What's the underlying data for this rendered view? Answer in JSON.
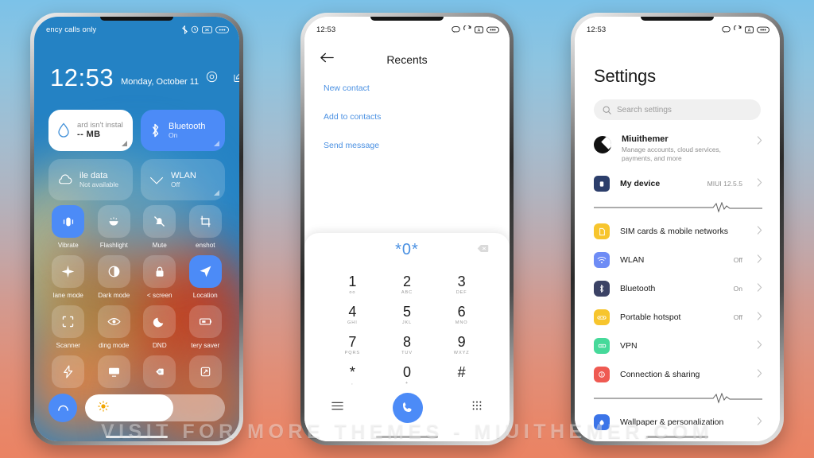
{
  "background": {
    "top_color": "#7cc2e8",
    "bottom_color": "#ea8363"
  },
  "watermark": {
    "text": "VISIT FOR MORE THEMES - MIUITHEMER.COM"
  },
  "phone1": {
    "name": "control-center",
    "statusbar": {
      "carrier": "ency calls only",
      "icons": [
        "bluetooth-icon",
        "alarm-icon",
        "mute-icon",
        "battery-icon"
      ]
    },
    "clock": {
      "time": "12:53",
      "date": "Monday, October 11",
      "icons": [
        "settings-gear-icon",
        "edit-icon"
      ]
    },
    "cards": [
      {
        "name": "storage-card",
        "icon": "water-drop-icon",
        "title": "ard isn't instal",
        "subtitle": "-- MB",
        "state": "white"
      },
      {
        "name": "bluetooth-card",
        "icon": "bluetooth-icon",
        "title": "Bluetooth",
        "subtitle": "On",
        "state": "on"
      },
      {
        "name": "mobile-data-card",
        "icon": "cloud-icon",
        "title": "ile data",
        "subtitle": "Not available",
        "state": "off"
      },
      {
        "name": "wlan-card",
        "icon": "wifi-icon",
        "title": "WLAN",
        "subtitle": "Off",
        "state": "off"
      }
    ],
    "tiles": [
      {
        "label": "Vibrate",
        "icon": "vibrate-icon",
        "active": true
      },
      {
        "label": "Flashlight",
        "icon": "flashlight-icon",
        "active": false
      },
      {
        "label": "Mute",
        "icon": "bell-off-icon",
        "active": false
      },
      {
        "label": "enshot",
        "icon": "screenshot-icon",
        "active": false
      },
      {
        "label": "lane mode",
        "icon": "airplane-icon",
        "active": false
      },
      {
        "label": "Dark mode",
        "icon": "contrast-icon",
        "active": false
      },
      {
        "label": "< screen",
        "icon": "lock-icon",
        "active": false
      },
      {
        "label": "Location",
        "icon": "location-icon",
        "active": true
      },
      {
        "label": "Scanner",
        "icon": "scanner-icon",
        "active": false
      },
      {
        "label": "ding mode",
        "icon": "eye-icon",
        "active": false
      },
      {
        "label": "DND",
        "icon": "moon-icon",
        "active": false
      },
      {
        "label": "tery saver",
        "icon": "battery-saver-icon",
        "active": false
      },
      {
        "label": "",
        "icon": "bolt-icon",
        "active": false
      },
      {
        "label": "",
        "icon": "cast-icon",
        "active": false
      },
      {
        "label": "",
        "icon": "reading-icon",
        "active": false
      },
      {
        "label": "",
        "icon": "rotate-icon",
        "active": false
      }
    ],
    "brightness": {
      "icon": "brightness-icon",
      "level_percent": 63,
      "left_button_icon": "arc-icon"
    }
  },
  "phone2": {
    "name": "dialer",
    "statusbar": {
      "time": "12:53",
      "icons": [
        "chat-icon",
        "rotate-icon",
        "vol-icon",
        "battery-icon"
      ]
    },
    "nav": {
      "back_icon": "back-arrow-icon",
      "title": "Recents"
    },
    "actions": [
      {
        "label": "New contact"
      },
      {
        "label": "Add to contacts"
      },
      {
        "label": "Send message"
      }
    ],
    "dialpad": {
      "number": "*0*",
      "delete_icon": "backspace-icon",
      "keys": [
        {
          "digit": "1",
          "letters": "oo"
        },
        {
          "digit": "2",
          "letters": "ABC"
        },
        {
          "digit": "3",
          "letters": "DEF"
        },
        {
          "digit": "4",
          "letters": "GHI"
        },
        {
          "digit": "5",
          "letters": "JKL"
        },
        {
          "digit": "6",
          "letters": "MNO"
        },
        {
          "digit": "7",
          "letters": "PQRS"
        },
        {
          "digit": "8",
          "letters": "TUV"
        },
        {
          "digit": "9",
          "letters": "WXYZ"
        },
        {
          "digit": "*",
          "letters": ","
        },
        {
          "digit": "0",
          "letters": "+"
        },
        {
          "digit": "#",
          "letters": ""
        }
      ],
      "left_icon": "menu-icon",
      "call_icon": "phone-icon",
      "right_icon": "keypad-icon"
    }
  },
  "phone3": {
    "name": "settings",
    "statusbar": {
      "time": "12:53",
      "icons": [
        "chat-icon",
        "rotate-icon",
        "vol-icon",
        "battery-icon"
      ]
    },
    "title": "Settings",
    "search": {
      "icon": "search-icon",
      "placeholder": "Search settings"
    },
    "account": {
      "name": "Miuithemer",
      "subtitle": "Manage accounts, cloud services, payments, and more",
      "avatar": "profile-avatar"
    },
    "rows": [
      {
        "label": "My device",
        "value": "MIUI 12.5.5",
        "icon": "device-icon",
        "color": "#2c3e6b",
        "bold": true
      },
      {
        "label": "SIM cards & mobile networks",
        "value": "",
        "icon": "sim-icon",
        "color": "#f7c52d",
        "bold": false
      },
      {
        "label": "WLAN",
        "value": "Off",
        "icon": "wifi-icon",
        "color": "#6e8cf5",
        "bold": false
      },
      {
        "label": "Bluetooth",
        "value": "On",
        "icon": "bluetooth-icon",
        "color": "#3b4265",
        "bold": false
      },
      {
        "label": "Portable hotspot",
        "value": "Off",
        "icon": "hotspot-icon",
        "color": "#f7c52d",
        "bold": false
      },
      {
        "label": "VPN",
        "value": "",
        "icon": "vpn-icon",
        "color": "#46d99a",
        "bold": false
      },
      {
        "label": "Connection & sharing",
        "value": "",
        "icon": "connection-icon",
        "color": "#ef5a52",
        "bold": false
      },
      {
        "label": "Wallpaper & personalization",
        "value": "",
        "icon": "wallpaper-icon",
        "color": "#3b74e8",
        "bold": false
      }
    ]
  }
}
